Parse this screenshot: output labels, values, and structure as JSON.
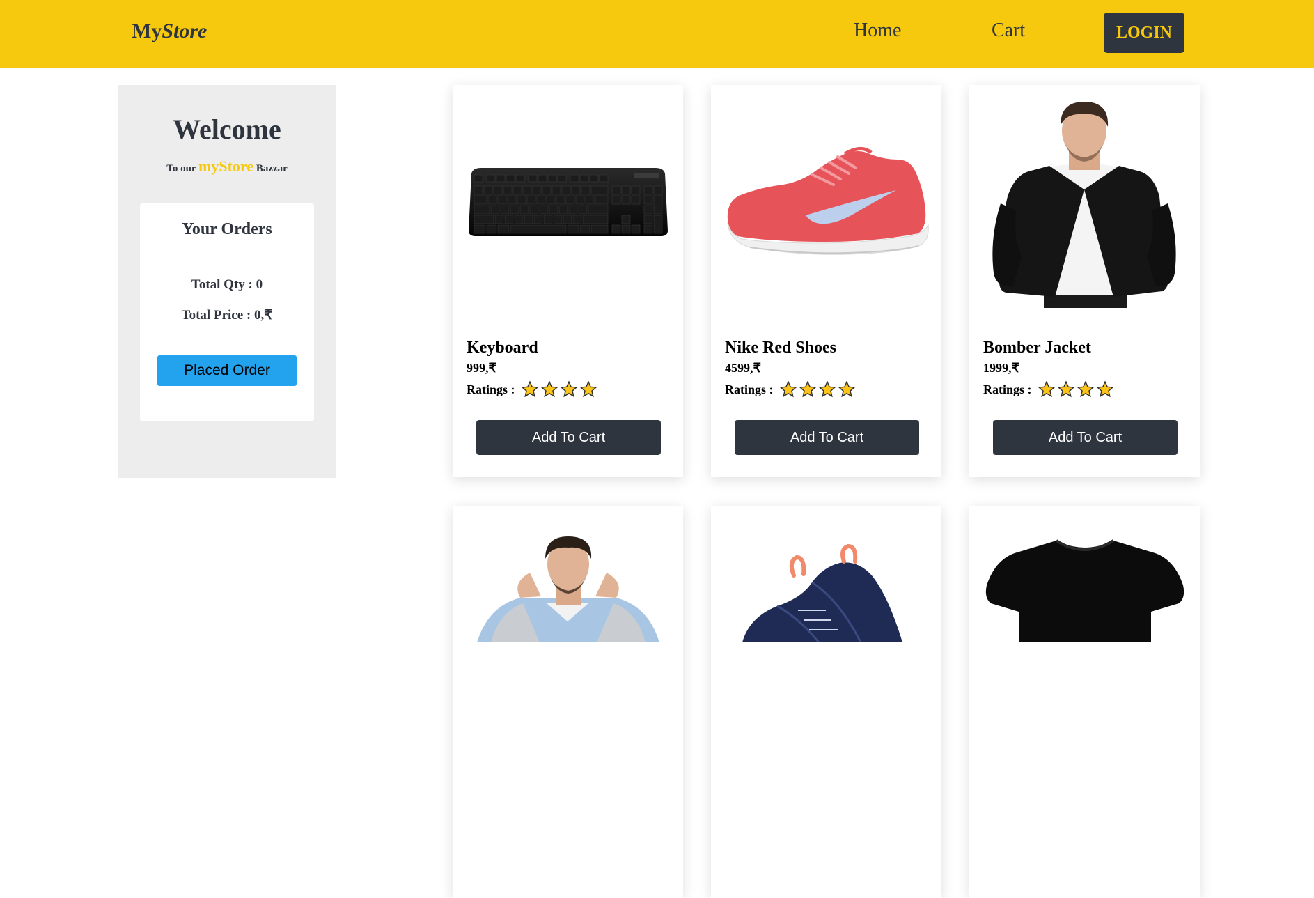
{
  "navbar": {
    "brand_part1": "My",
    "brand_part2": "Store",
    "home_label": "Home",
    "cart_label": "Cart",
    "login_label": "LOGIN",
    "bg_color": "#f6c90e",
    "dark_color": "#2f353e"
  },
  "sidebar": {
    "welcome": "Welcome",
    "tagline_prefix": "To our",
    "tagline_store": "myStore",
    "tagline_suffix": "Bazzar",
    "orders_title": "Your Orders",
    "total_qty": "Total Qty : 0",
    "total_price": "Total Price : 0,₹",
    "place_order_label": "Placed Order",
    "place_order_color": "#23a2ee"
  },
  "products": [
    {
      "name": "Keyboard",
      "price": "999,₹",
      "ratings_label": "Ratings :",
      "stars": 4,
      "add_label": "Add To Cart",
      "image_icon": "keyboard-image"
    },
    {
      "name": "Nike Red Shoes",
      "price": "4599,₹",
      "ratings_label": "Ratings :",
      "stars": 4,
      "add_label": "Add To Cart",
      "image_icon": "shoe-image"
    },
    {
      "name": "Bomber Jacket",
      "price": "1999,₹",
      "ratings_label": "Ratings :",
      "stars": 4,
      "add_label": "Add To Cart",
      "image_icon": "jacket-image"
    },
    {
      "image_icon": "denim-jacket-image"
    },
    {
      "image_icon": "navy-shoe-image"
    },
    {
      "image_icon": "black-tshirt-image"
    }
  ]
}
